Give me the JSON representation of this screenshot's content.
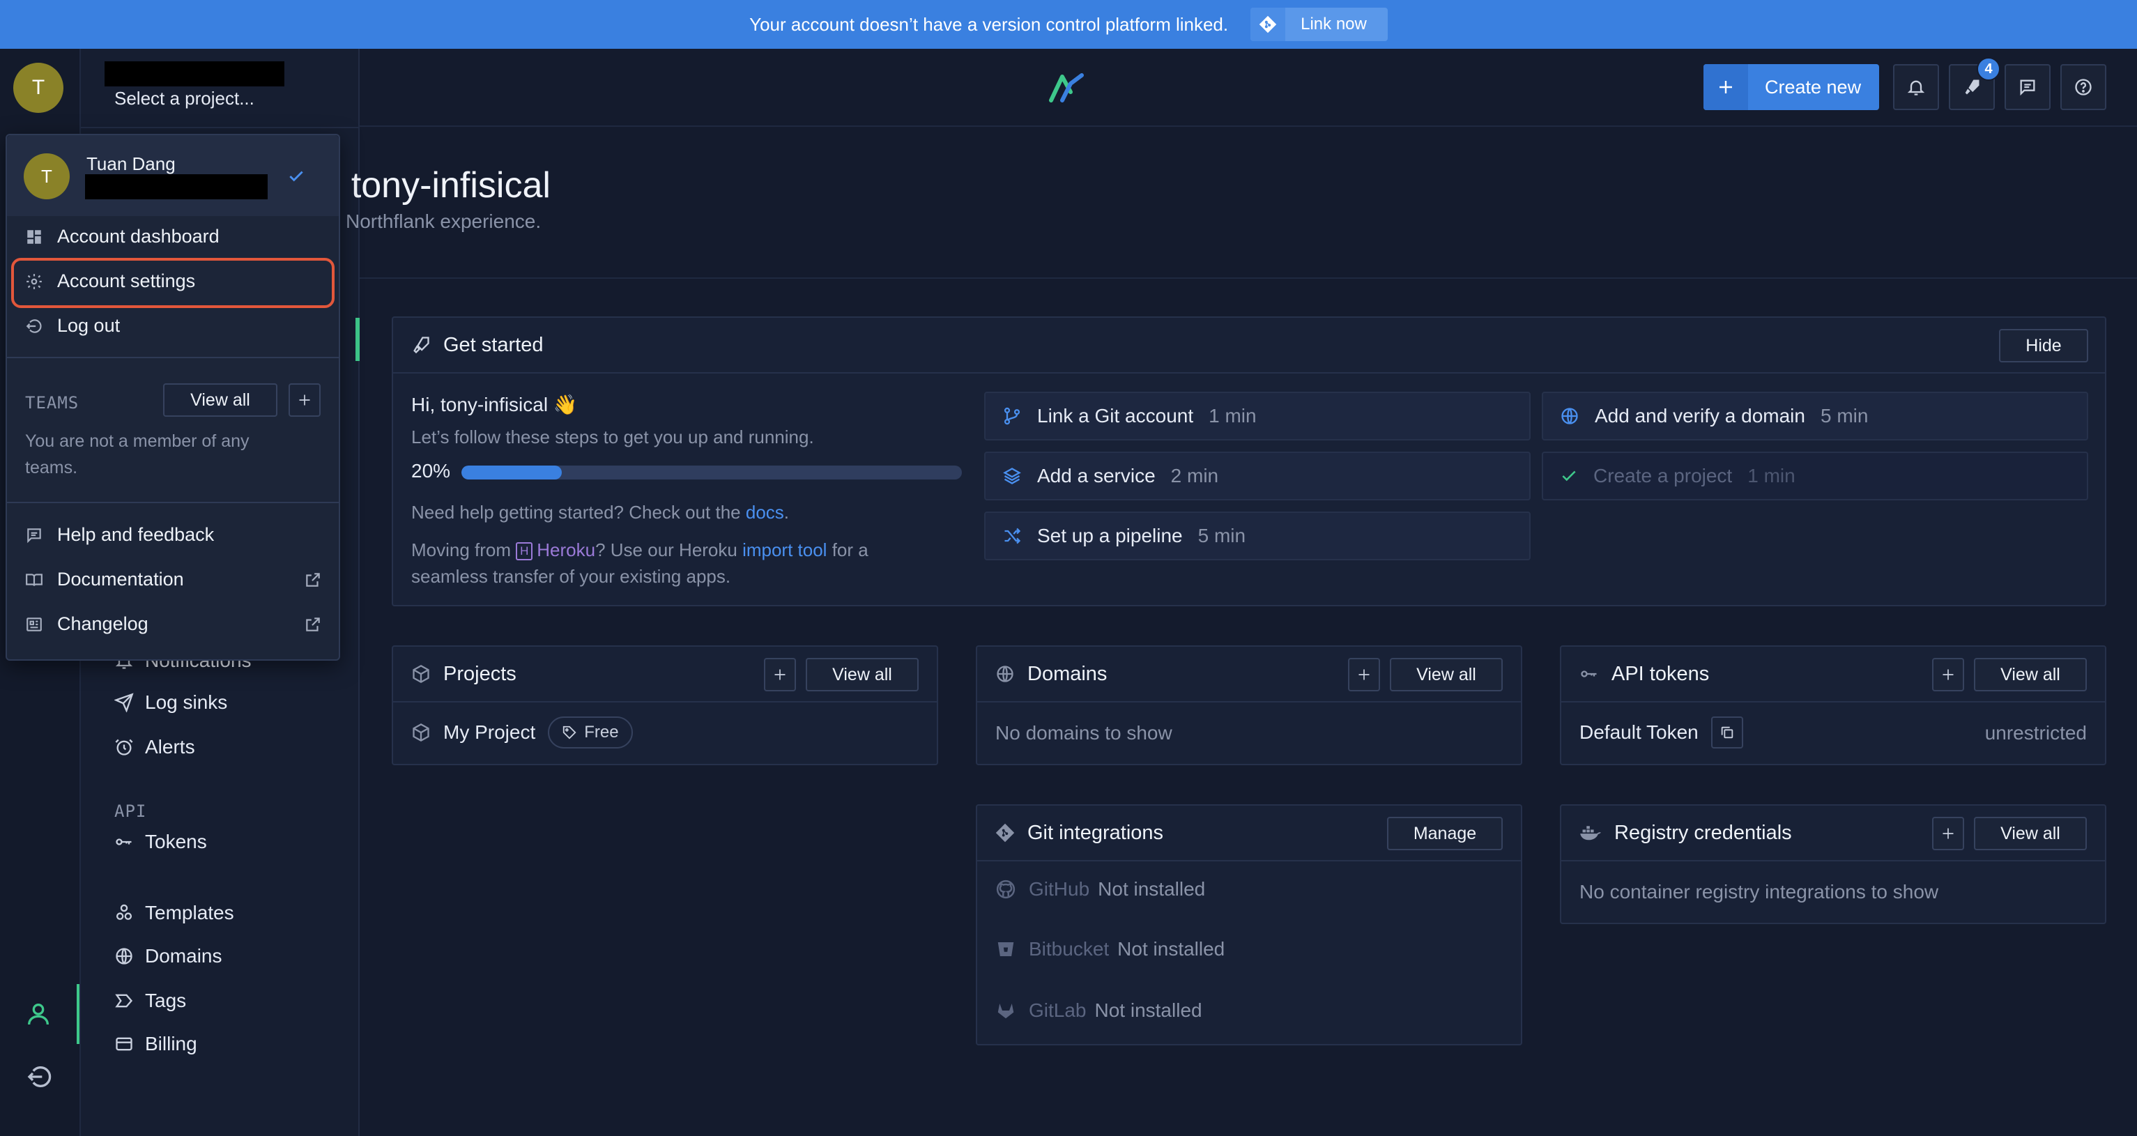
{
  "banner": {
    "message": "Your account doesn’t have a version control platform linked.",
    "link_label": "Link now"
  },
  "rail": {
    "avatar_initial": "T"
  },
  "sidebar": {
    "project_select": "Select a project...",
    "items_top": [
      {
        "label": "Notifications",
        "icon": "bell-icon"
      },
      {
        "label": "Log sinks",
        "icon": "send-icon"
      },
      {
        "label": "Alerts",
        "icon": "alarm-icon"
      }
    ],
    "api_label": "API",
    "tokens_label": "Tokens",
    "items_bottom": [
      {
        "label": "Templates",
        "icon": "templates-icon"
      },
      {
        "label": "Domains",
        "icon": "globe-icon"
      },
      {
        "label": "Tags",
        "icon": "tag-icon"
      },
      {
        "label": "Billing",
        "icon": "credit-card-icon"
      }
    ]
  },
  "header": {
    "create_new": "Create new",
    "rocket_badge": "4"
  },
  "welcome": {
    "title": "e, tony-infisical",
    "subtitle": "Northflank experience."
  },
  "dropdown": {
    "avatar_initial": "T",
    "user_name": "Tuan Dang",
    "account_dashboard": "Account dashboard",
    "account_settings": "Account settings",
    "log_out": "Log out",
    "teams_label": "TEAMS",
    "teams_view_all": "View all",
    "teams_note": "You are not a member of any teams.",
    "help": "Help and feedback",
    "documentation": "Documentation",
    "changelog": "Changelog"
  },
  "get_started": {
    "title": "Get started",
    "hide": "Hide",
    "greeting": "Hi, tony-infisical 👋",
    "intro": "Let’s follow these steps to get you up and running.",
    "progress_label": "20%",
    "progress": 0.2,
    "help_prefix": "Need help getting started? Check out the ",
    "help_link": "docs",
    "help_suffix": ".",
    "moving_prefix": "Moving from ",
    "heroku": "Heroku",
    "moving_mid": "? Use our Heroku ",
    "import_tool": "import tool",
    "moving_suffix": " for a",
    "moving_line2": "seamless transfer of your existing apps.",
    "steps": [
      {
        "label": "Link a Git account",
        "time": "1 min",
        "icon": "git-branch-icon"
      },
      {
        "label": "Add and verify a domain",
        "time": "5 min",
        "icon": "globe-icon"
      },
      {
        "label": "Add a service",
        "time": "2 min",
        "icon": "layers-icon"
      },
      {
        "label": "Create a project",
        "time": "1 min",
        "icon": "check-icon",
        "done": true
      },
      {
        "label": "Set up a pipeline",
        "time": "5 min",
        "icon": "shuffle-icon"
      }
    ]
  },
  "projects": {
    "title": "Projects",
    "view_all": "View all",
    "item_name": "My Project",
    "item_tag": "Free"
  },
  "domains": {
    "title": "Domains",
    "view_all": "View all",
    "empty": "No domains to show"
  },
  "api_tokens": {
    "title": "API tokens",
    "view_all": "View all",
    "token_name": "Default Token",
    "token_scope": "unrestricted"
  },
  "git_integrations": {
    "title": "Git integrations",
    "manage": "Manage",
    "providers": [
      {
        "name": "GitHub",
        "status": "Not installed"
      },
      {
        "name": "Bitbucket",
        "status": "Not installed"
      },
      {
        "name": "GitLab",
        "status": "Not installed"
      }
    ]
  },
  "registry": {
    "title": "Registry credentials",
    "view_all": "View all",
    "empty": "No container registry integrations to show"
  },
  "colors": {
    "accent": "#3a80e0",
    "success": "#3ec88b",
    "highlight": "#e2573b",
    "background": "#141b2d"
  }
}
